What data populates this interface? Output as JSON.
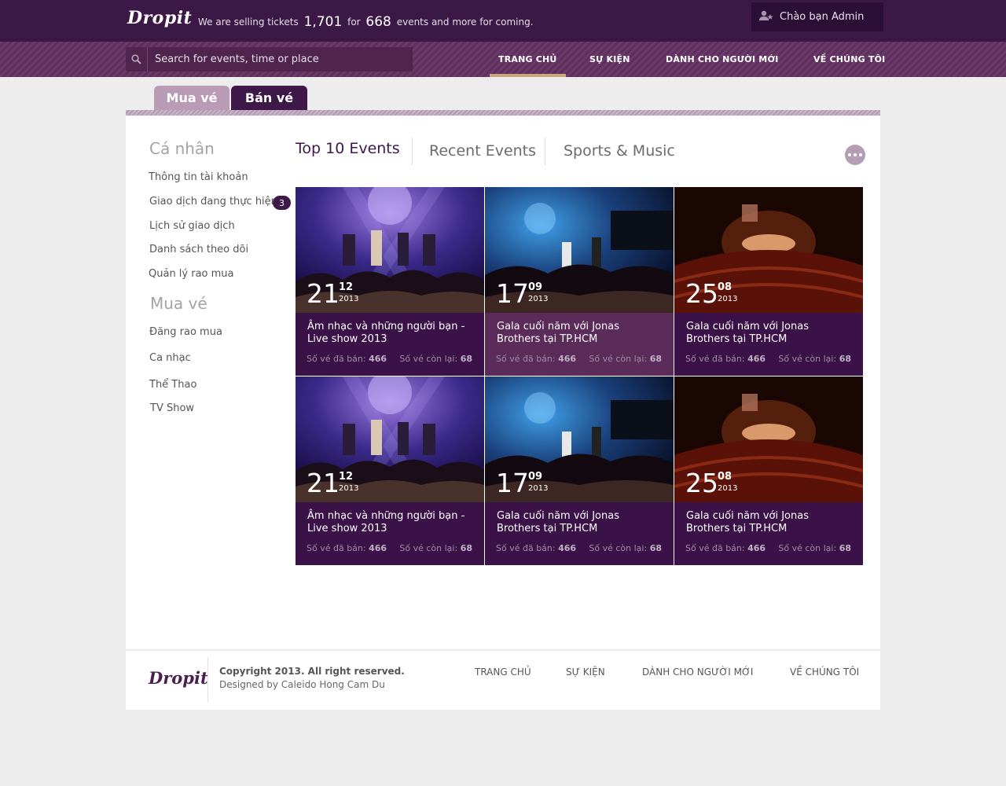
{
  "header": {
    "logo": "Dropit",
    "tagline": {
      "prefix": "We are selling tickets",
      "tickets": "1,701",
      "for": "for",
      "events": "668",
      "suffix": "events and more for coming."
    },
    "user_greeting": "Chào bạn Admin",
    "search_placeholder": "Search for events, time or place"
  },
  "nav": [
    {
      "label": "TRANG CHỦ",
      "active": true
    },
    {
      "label": "SỰ KIỆN",
      "active": false
    },
    {
      "label": "DÀNH CHO NGƯỜI MỚI",
      "active": false
    },
    {
      "label": "VỀ CHÚNG TÔI",
      "active": false
    }
  ],
  "tabs": {
    "buy": "Mua vé",
    "sell": "Bán vé"
  },
  "sidebar": {
    "personal_title": "Cá nhân",
    "personal_items": [
      "Thông tin tài khoản",
      "Giao dịch đang thực hiện",
      "Lịch sử giao dịch",
      "Danh sách theo dõi",
      "Quản lý rao mua"
    ],
    "pending_count": "3",
    "buy_title": "Mua vé",
    "buy_items": [
      "Đăng rao mua",
      "Ca nhạc",
      "Thể Thao",
      "TV Show"
    ]
  },
  "filters": {
    "top10": "Top 10 Events",
    "recent": "Recent Events",
    "sports": "Sports & Music"
  },
  "events": [
    {
      "day": "21",
      "month": "12",
      "year": "2013",
      "title": "Âm nhạc và những người bạn - Live show 2013",
      "sold_label": "Số vé đã bán:",
      "sold": "466",
      "left_label": "Số vé còn lại:",
      "left": "68"
    },
    {
      "day": "17",
      "month": "09",
      "year": "2013",
      "title": "Gala cuối năm với Jonas Brothers tại TP.HCM",
      "sold_label": "Số vé đã bán:",
      "sold": "466",
      "left_label": "Số vé còn lại:",
      "left": "68"
    },
    {
      "day": "25",
      "month": "08",
      "year": "2013",
      "title": "Gala cuối năm với Jonas Brothers tại TP.HCM",
      "sold_label": "Số vé đã bán:",
      "sold": "466",
      "left_label": "Số vé còn lại:",
      "left": "68"
    },
    {
      "day": "21",
      "month": "12",
      "year": "2013",
      "title": "Âm nhạc và những người bạn - Live show 2013",
      "sold_label": "Số vé đã bán:",
      "sold": "466",
      "left_label": "Số vé còn lại:",
      "left": "68"
    },
    {
      "day": "17",
      "month": "09",
      "year": "2013",
      "title": "Gala cuối năm với Jonas Brothers tại TP.HCM",
      "sold_label": "Số vé đã bán:",
      "sold": "466",
      "left_label": "Số vé còn lại:",
      "left": "68"
    },
    {
      "day": "25",
      "month": "08",
      "year": "2013",
      "title": "Gala cuối năm với Jonas Brothers tại TP.HCM",
      "sold_label": "Số vé đã bán:",
      "sold": "466",
      "left_label": "Số vé còn lại:",
      "left": "68"
    }
  ],
  "footer": {
    "logo": "Dropit",
    "copyright": "Copyright 2013. All right reserved.",
    "designed_by": "Designed by Caleido Hong Cam Du",
    "links": [
      "TRANG CHỦ",
      "SỰ KIỆN",
      "DÀNH CHO NGƯỜI MỚI",
      "VỀ CHÚNG TÔI"
    ]
  },
  "colors": {
    "brand_dark": "#3b1846",
    "nav_stripe": "#6a3a68",
    "card_bg": "#3a1248",
    "nav_active_underline": "#c9a880"
  },
  "icons": [
    "user-star-icon",
    "search-icon",
    "more-dots-icon"
  ]
}
